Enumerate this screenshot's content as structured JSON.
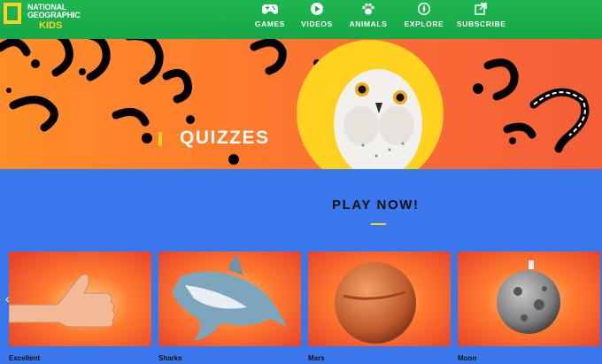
{
  "brand": {
    "line1": "NATIONAL",
    "line2": "GEOGRAPHIC",
    "kids": "KIDS",
    "accent": "#ffd21f"
  },
  "nav": {
    "games": "GAMES",
    "videos": "VIDEOS",
    "animals": "ANIMALS",
    "explore": "EXPLORE",
    "subscribe": "SUBSCRIBE",
    "icons": [
      "gamepad-icon",
      "play-icon",
      "paw-icon",
      "compass-icon",
      "external-link-icon"
    ]
  },
  "hero": {
    "title": "QUIZZES",
    "background": "#f8732f",
    "circle_color": "#ffd21f"
  },
  "play": {
    "heading": "PLAY NOW!",
    "section_bg": "#3b77ec"
  },
  "cards": [
    {
      "label": "Excellent",
      "image": "thumbs-up-image"
    },
    {
      "label": "Sharks",
      "image": "shark-image"
    },
    {
      "label": "Mars",
      "image": "planet-mars-image"
    },
    {
      "label": "Moon",
      "image": "moon-image"
    }
  ],
  "carousel": {
    "prev": "‹"
  }
}
